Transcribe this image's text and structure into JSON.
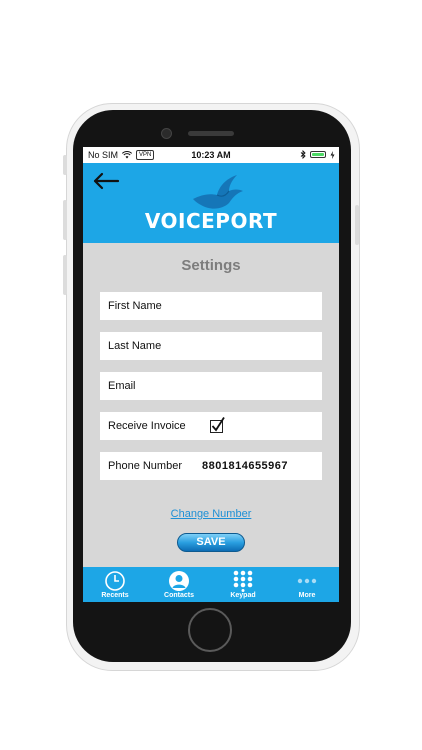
{
  "status_bar": {
    "carrier": "No SIM",
    "vpn": "VPN",
    "time": "10:23 AM"
  },
  "header": {
    "logo_text": "VOICEPORT"
  },
  "page": {
    "title": "Settings"
  },
  "form": {
    "first_name_label": "First Name",
    "last_name_label": "Last Name",
    "email_label": "Email",
    "receive_invoice_label": "Receive Invoice",
    "receive_invoice_checked": true,
    "phone_number_label": "Phone Number",
    "phone_number_value": "8801814655967"
  },
  "actions": {
    "change_number": "Change Number",
    "save": "SAVE"
  },
  "tabs": [
    {
      "label": "Recents",
      "icon": "clock-icon"
    },
    {
      "label": "Contacts",
      "icon": "person-icon"
    },
    {
      "label": "Keypad",
      "icon": "keypad-icon"
    },
    {
      "label": "More",
      "icon": "more-dots-icon"
    }
  ],
  "colors": {
    "accent": "#1da6e6",
    "screen_bg": "#d7d7d7",
    "link": "#1e90d6"
  }
}
